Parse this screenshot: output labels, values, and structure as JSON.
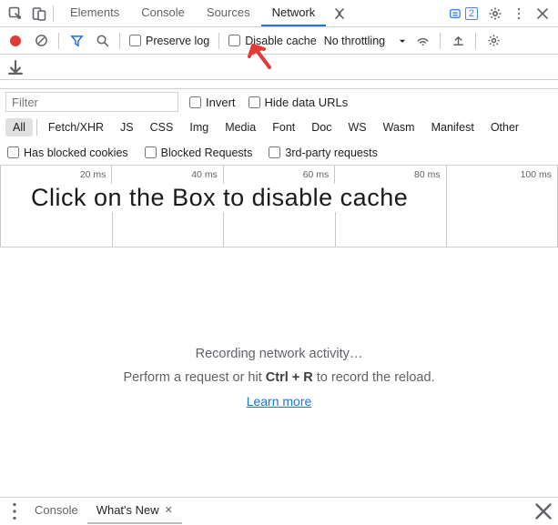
{
  "topbar": {
    "tabs": [
      "Elements",
      "Console",
      "Sources",
      "Network"
    ],
    "active": 3,
    "badge_count": "2"
  },
  "toolbar": {
    "preserve_log": "Preserve log",
    "disable_cache": "Disable cache",
    "throttling": "No throttling"
  },
  "filter": {
    "placeholder": "Filter",
    "invert": "Invert",
    "hide_data_urls": "Hide data URLs"
  },
  "types": [
    "All",
    "Fetch/XHR",
    "JS",
    "CSS",
    "Img",
    "Media",
    "Font",
    "Doc",
    "WS",
    "Wasm",
    "Manifest",
    "Other"
  ],
  "types_active": 0,
  "extra": {
    "blocked_cookies": "Has blocked cookies",
    "blocked_requests": "Blocked Requests",
    "third_party": "3rd-party requests"
  },
  "timeline": {
    "ticks": [
      "20 ms",
      "40 ms",
      "60 ms",
      "80 ms",
      "100 ms"
    ]
  },
  "annotation": "Click on the Box to disable cache",
  "main": {
    "title": "Recording network activity…",
    "hint_before": "Perform a request or hit ",
    "hint_key": "Ctrl + R",
    "hint_after": " to record the reload.",
    "learn_more": "Learn more"
  },
  "drawer": {
    "tabs": [
      "Console",
      "What's New"
    ],
    "active": 1
  },
  "colors": {
    "accent": "#1a73e8",
    "record": "#e53935"
  }
}
